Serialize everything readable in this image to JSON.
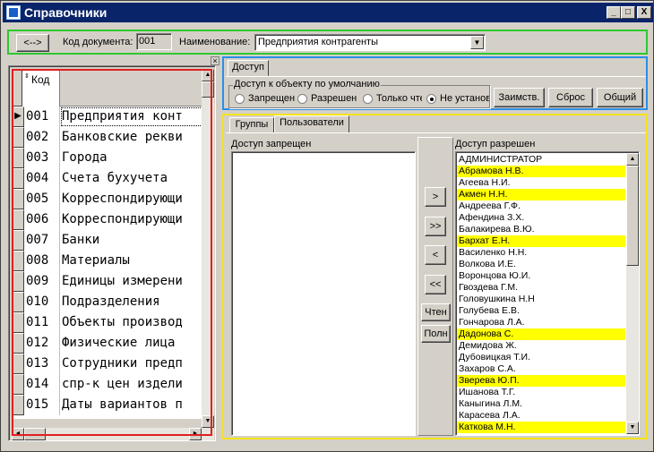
{
  "window": {
    "title": "Справочники",
    "controls": [
      "_",
      "□",
      "X"
    ]
  },
  "toolbar": {
    "nav_button": "<-->",
    "doc_code_label": "Код документа:",
    "doc_code_value": "001",
    "name_label": "Наименование:",
    "name_value": "Предприятия контрагенты"
  },
  "grid": {
    "code_header": "Код",
    "rows": [
      {
        "code": "001",
        "name": "Предприятия конт"
      },
      {
        "code": "002",
        "name": "Банковские рекви"
      },
      {
        "code": "003",
        "name": "Города"
      },
      {
        "code": "004",
        "name": "Счета бухучета"
      },
      {
        "code": "005",
        "name": "Корреспондирующи"
      },
      {
        "code": "006",
        "name": "Корреспондирующи"
      },
      {
        "code": "007",
        "name": "Банки"
      },
      {
        "code": "008",
        "name": "Материалы"
      },
      {
        "code": "009",
        "name": "Единицы измерени"
      },
      {
        "code": "010",
        "name": "Подразделения"
      },
      {
        "code": "011",
        "name": "Объекты производ"
      },
      {
        "code": "012",
        "name": "Физические лица"
      },
      {
        "code": "013",
        "name": "Сотрудники предп"
      },
      {
        "code": "014",
        "name": "спр-к цен издели"
      },
      {
        "code": "015",
        "name": "Даты вариантов п"
      }
    ]
  },
  "access": {
    "tab": "Доступ",
    "group_label": "Доступ к объекту по умолчанию",
    "options": [
      "Запрещен",
      "Разрешен",
      "Только чте",
      "Не установ"
    ],
    "selected_index": 3,
    "buttons": {
      "borrow": "Заимств.",
      "reset": "Сброс",
      "common": "Общий"
    }
  },
  "lists": {
    "tabs": [
      "Группы",
      "Пользователи"
    ],
    "active_tab": "Пользователи",
    "denied_header": "Доступ запрещен",
    "allowed_header": "Доступ разрешен",
    "move_buttons": [
      ">",
      ">>",
      "<",
      "<<"
    ],
    "read_button": "Чтен",
    "full_button": "Полн",
    "highlight_color": "#ffff00",
    "allowed_users": [
      {
        "name": "АДМИНИСТРАТОР",
        "hl": false
      },
      {
        "name": "Абрамова Н.В.",
        "hl": true
      },
      {
        "name": "Агеева Н.И.",
        "hl": false
      },
      {
        "name": "Акмен Н.Н.",
        "hl": true
      },
      {
        "name": "Андреева Г.Ф.",
        "hl": false
      },
      {
        "name": "Афендина З.Х.",
        "hl": false
      },
      {
        "name": "Балакирева В.Ю.",
        "hl": false
      },
      {
        "name": "Бархат Е.Н.",
        "hl": true
      },
      {
        "name": "Василенко Н.Н.",
        "hl": false
      },
      {
        "name": "Волкова И.Е.",
        "hl": false
      },
      {
        "name": "Воронцова Ю.И.",
        "hl": false
      },
      {
        "name": "Гвоздева Г.М.",
        "hl": false
      },
      {
        "name": "Головушкина Н.Н",
        "hl": false
      },
      {
        "name": "Голубева Е.В.",
        "hl": false
      },
      {
        "name": "Гончарова Л.А.",
        "hl": false
      },
      {
        "name": "Дадонова С.",
        "hl": true
      },
      {
        "name": "Демидова Ж.",
        "hl": false
      },
      {
        "name": "Дубовицкая Т.И.",
        "hl": false
      },
      {
        "name": "Захаров С.А.",
        "hl": false
      },
      {
        "name": "Зверева Ю.П.",
        "hl": true
      },
      {
        "name": "Ишанова Т.Г.",
        "hl": false
      },
      {
        "name": "Каныгина Л.М.",
        "hl": false
      },
      {
        "name": "Карасева Л.А.",
        "hl": false
      },
      {
        "name": "Каткова М.Н.",
        "hl": true
      }
    ]
  }
}
